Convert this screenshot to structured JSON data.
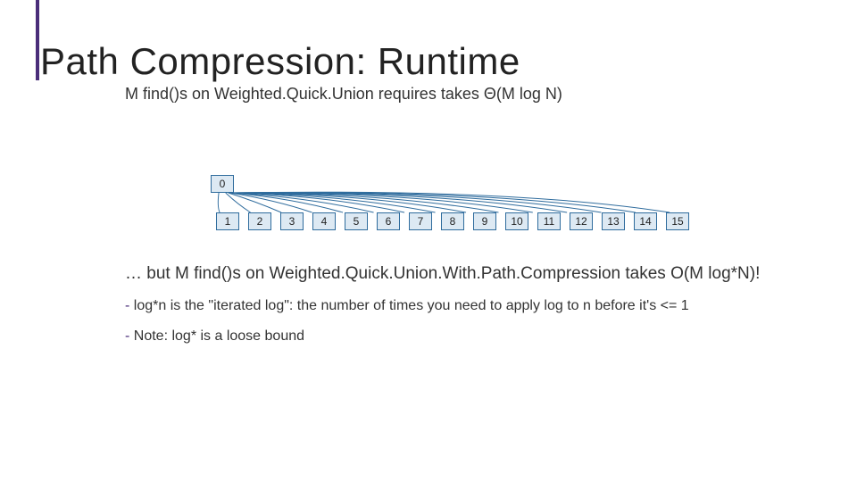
{
  "title": "Path Compression: Runtime",
  "subtitle": "M find()s on Weighted.Quick.Union requires takes Θ(M log N)",
  "nodes": {
    "root": "0",
    "c1": "1",
    "c2": "2",
    "c3": "3",
    "c4": "4",
    "c5": "5",
    "c6": "6",
    "c7": "7",
    "c8": "8",
    "c9": "9",
    "c10": "10",
    "c11": "11",
    "c12": "12",
    "c13": "13",
    "c14": "14",
    "c15": "15"
  },
  "after_tree": "… but M find()s on Weighted.Quick.Union.With.Path.Compression takes O(M log*N)!",
  "bullet1_dash": "-",
  "bullet1": " log*n is the \"iterated log\": the number of times you need to apply log to n before it's <= 1",
  "bullet2_dash": "-",
  "bullet2": " Note: log* is a loose bound"
}
